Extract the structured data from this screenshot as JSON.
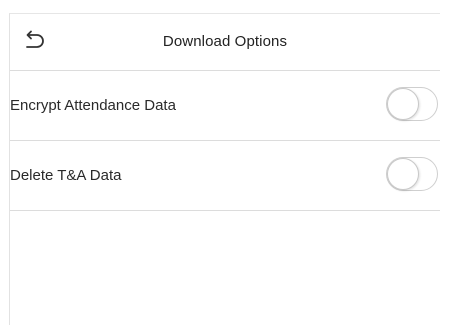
{
  "header": {
    "title": "Download Options",
    "back_icon": "undo-arrow-icon"
  },
  "options": [
    {
      "label": "Encrypt Attendance Data",
      "enabled": false
    },
    {
      "label": "Delete T&A Data",
      "enabled": false
    }
  ],
  "colors": {
    "background": "#ffffff",
    "divider": "#dcdcdc",
    "text": "#2a2a2a",
    "toggle_border": "#cfcfcf"
  }
}
